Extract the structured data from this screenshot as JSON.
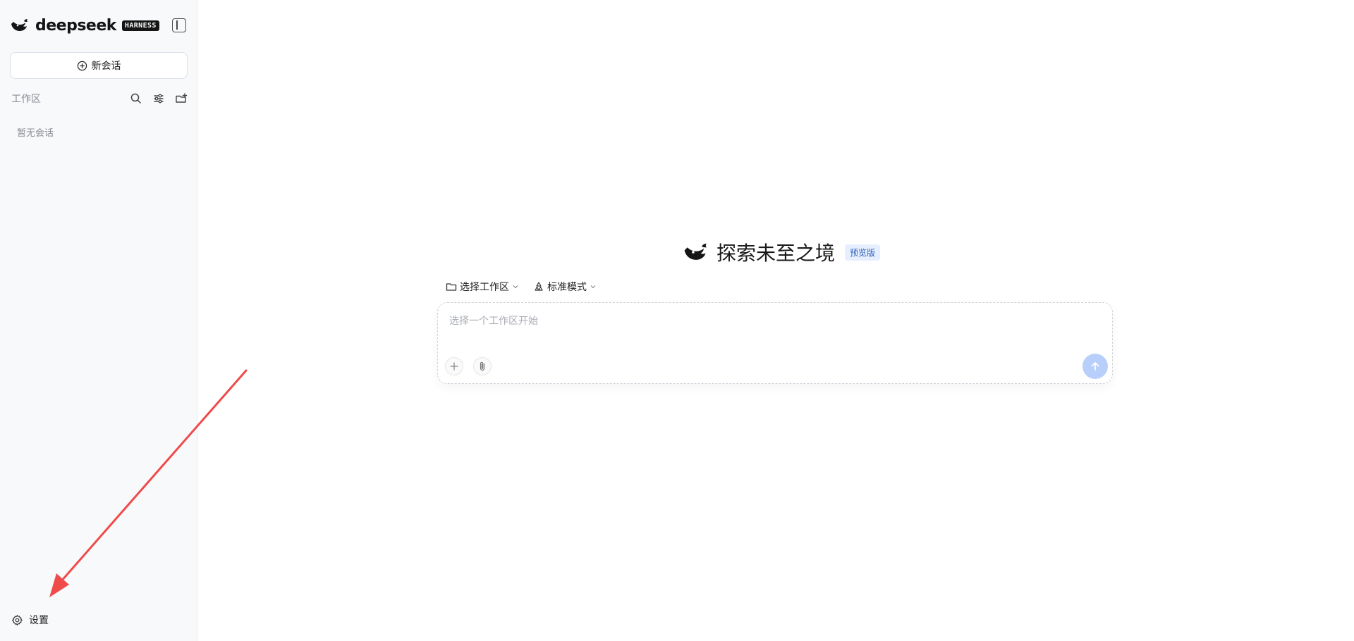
{
  "sidebar": {
    "brand": {
      "name": "deepseek",
      "badge": "HARNESS"
    },
    "new_chat_label": "新会话",
    "workspace_label": "工作区",
    "empty_hint": "暂无会话",
    "settings_label": "设置"
  },
  "main": {
    "hero_title": "探索未至之境",
    "hero_badge": "预览版",
    "workspace_selector": "选择工作区",
    "mode_selector": "标准模式",
    "composer_placeholder": "选择一个工作区开始"
  },
  "colors": {
    "sidebar_bg": "#f8f9fb",
    "accent_blue": "#b8cffb",
    "badge_bg": "#e6efff",
    "badge_text": "#2f5fb8",
    "annotation_arrow": "#ef4b4b"
  },
  "icons": [
    "deepseek-whale-icon",
    "sidebar-collapse-icon",
    "plus-circle-icon",
    "search-icon",
    "sliders-icon",
    "new-folder-icon",
    "gear-icon",
    "folder-icon",
    "recycle-icon",
    "chevron-down-icon",
    "plus-icon",
    "paperclip-icon",
    "arrow-up-icon"
  ]
}
